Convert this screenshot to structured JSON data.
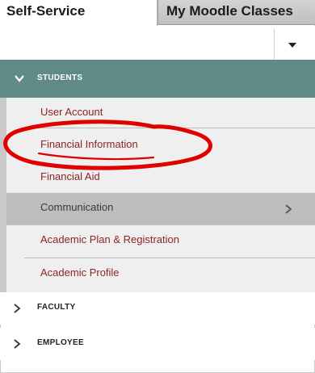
{
  "tabs": [
    {
      "label": "Self-Service",
      "active": true
    },
    {
      "label": "My Moodle Classes",
      "active": false
    }
  ],
  "dropdown": {
    "icon": "caret-down-icon"
  },
  "students": {
    "label": "STUDENTS",
    "icon": "chevron-down-icon",
    "header_color": "#5f8a86",
    "items": [
      {
        "label": "User Account"
      },
      {
        "label": "Financial Information"
      },
      {
        "label": "Financial Aid"
      },
      {
        "label": "Communication",
        "has_submenu": true
      },
      {
        "label": "Academic Plan & Registration"
      },
      {
        "label": "Academic Profile"
      }
    ]
  },
  "sections": [
    {
      "label": "FACULTY",
      "icon": "chevron-right-icon"
    },
    {
      "label": "EMPLOYEE",
      "icon": "chevron-right-icon"
    }
  ],
  "colors": {
    "link": "#8d2424",
    "highlight_bg": "#bdbdbd",
    "annotation": "#e00000"
  }
}
